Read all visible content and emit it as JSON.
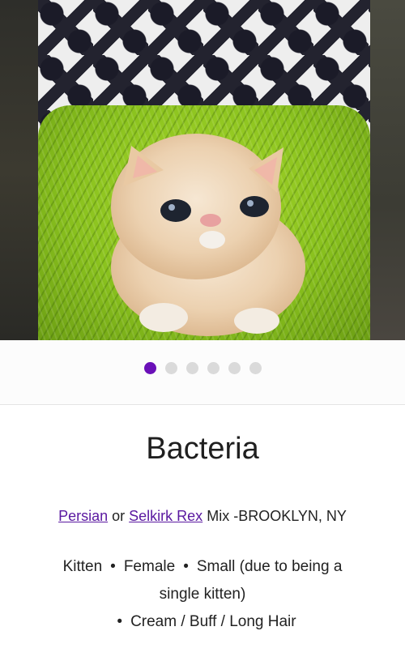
{
  "gallery": {
    "photo_count": 6,
    "active_index": 0,
    "accent_color": "#6a10b8",
    "photo_subject": "cream-kitten-on-green-rug"
  },
  "pet": {
    "name": "Bacteria",
    "breed_primary": "Persian",
    "breed_connector": "or",
    "breed_secondary": "Selkirk Rex",
    "breed_suffix": "Mix",
    "location": "-BROOKLYN, NY",
    "age": "Kitten",
    "sex": "Female",
    "size": "Small (due to being a",
    "size_cont": "single kitten)",
    "coat": "Cream / Buff / Long Hair",
    "bullet": "•"
  }
}
